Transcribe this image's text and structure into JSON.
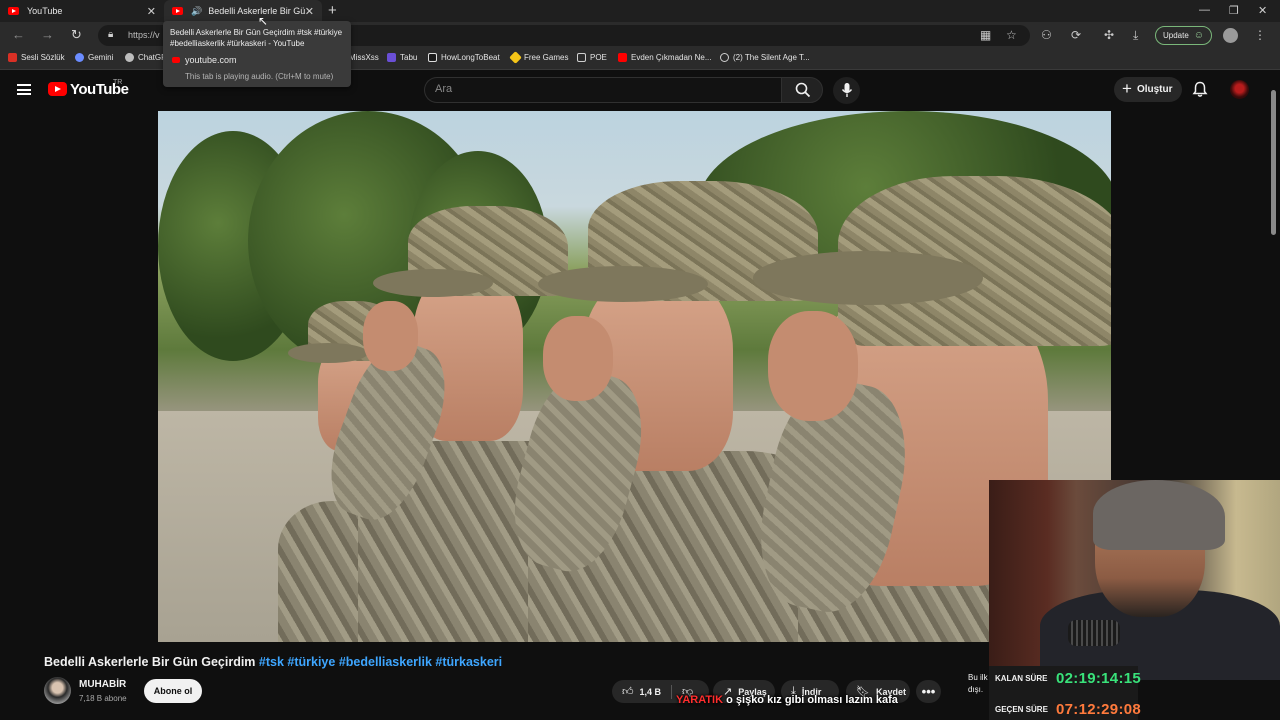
{
  "browser": {
    "tabs": [
      {
        "label": "YouTube"
      },
      {
        "label": "Bedelli Askerlerle Bir Gün Geçirdim"
      }
    ],
    "url": "https://v",
    "update_label": "Update",
    "bookmarks": [
      {
        "label": "Sesli Sözlük",
        "color": "#d93025"
      },
      {
        "label": "Gemini",
        "color": "#6b8cff"
      },
      {
        "label": "ChatGPT",
        "color": "#bdbdbd"
      },
      {
        "label": "MissXss",
        "color": "#8a8a8a"
      },
      {
        "label": "Tabu",
        "color": "#6a4fd6"
      },
      {
        "label": "HowLongToBeat",
        "color": "#1a1a1a"
      },
      {
        "label": "Free Games",
        "color": "#f5c518"
      },
      {
        "label": "POE",
        "color": "#9e9e9e"
      },
      {
        "label": "Evden Çıkmadan Ne...",
        "color": "#ff0000"
      },
      {
        "label": "(2) The Silent Age T...",
        "color": "#bdbdbd"
      }
    ],
    "tooltip": {
      "title": "Bedelli Askerlerle Bir Gün Geçirdim #tsk #türkiye #bedelliaskerlik #türkaskeri - YouTube",
      "domain": "youtube.com",
      "note": "This tab is playing audio. (Ctrl+M to mute)"
    }
  },
  "youtube": {
    "logo_text": "YouTube",
    "country_code": "TR",
    "search_placeholder": "Ara",
    "create_label": "Oluştur",
    "video": {
      "title": "Bedelli Askerlerle Bir Gün Geçirdim",
      "hashtags": "#tsk #türkiye #bedelliaskerlik #türkaskeri"
    },
    "channel": {
      "name": "MUHABİR",
      "subscribers": "7,18 B abone",
      "subscribe_label": "Abone ol"
    },
    "actions": {
      "likes": "1,4 B",
      "share": "Paylaş",
      "download": "İndir",
      "save": "Kaydet"
    },
    "description_peek": "Bu ilk dışı."
  },
  "stream_overlay": {
    "remaining_label": "KALAN SÜRE",
    "remaining_value": "02:19:14:15",
    "elapsed_label": "GEÇEN SÜRE",
    "elapsed_value": "07:12:29:08",
    "chat_user": "YARATIK",
    "chat_message": "o şişko kız gibi olması lazım kafa",
    "remaining_color": "#39e27a",
    "elapsed_color": "#ff7a3c"
  }
}
